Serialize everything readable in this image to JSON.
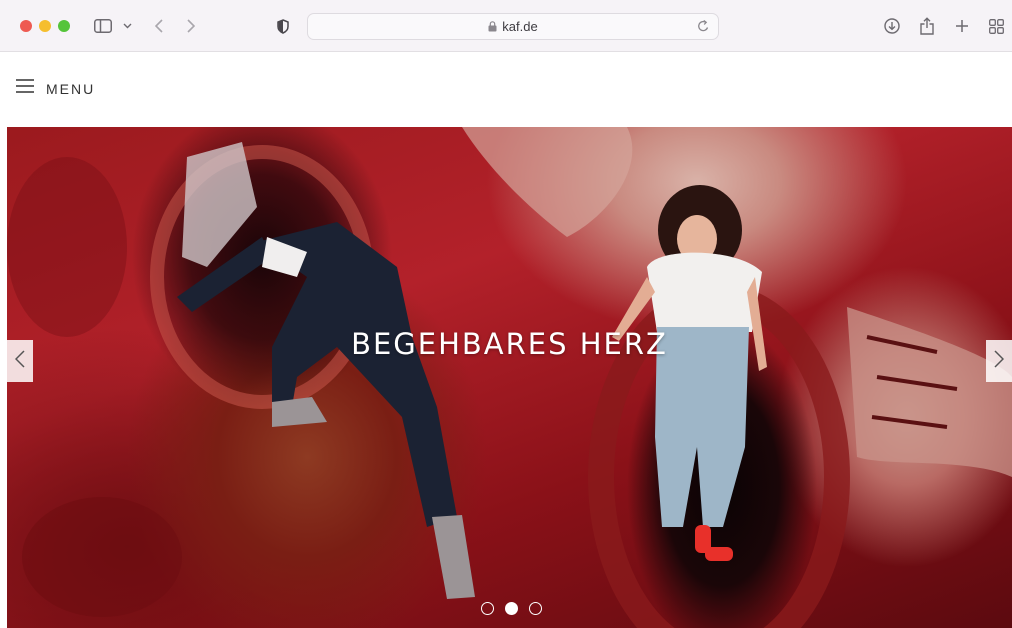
{
  "browser": {
    "url": "kaf.de",
    "icons": [
      "sidebar-icon",
      "chevron-down-icon",
      "back-icon",
      "forward-icon",
      "shield-icon",
      "lock-icon",
      "reload-icon",
      "download-icon",
      "share-icon",
      "new-tab-icon",
      "tab-overview-icon"
    ]
  },
  "header": {
    "menu_label": "MENU"
  },
  "slider": {
    "title": "BEGEHBARES HERZ",
    "slide_count": 3,
    "active_slide": 2
  },
  "colors": {
    "hero_red": "#b3212a",
    "menu_text": "#333333"
  }
}
